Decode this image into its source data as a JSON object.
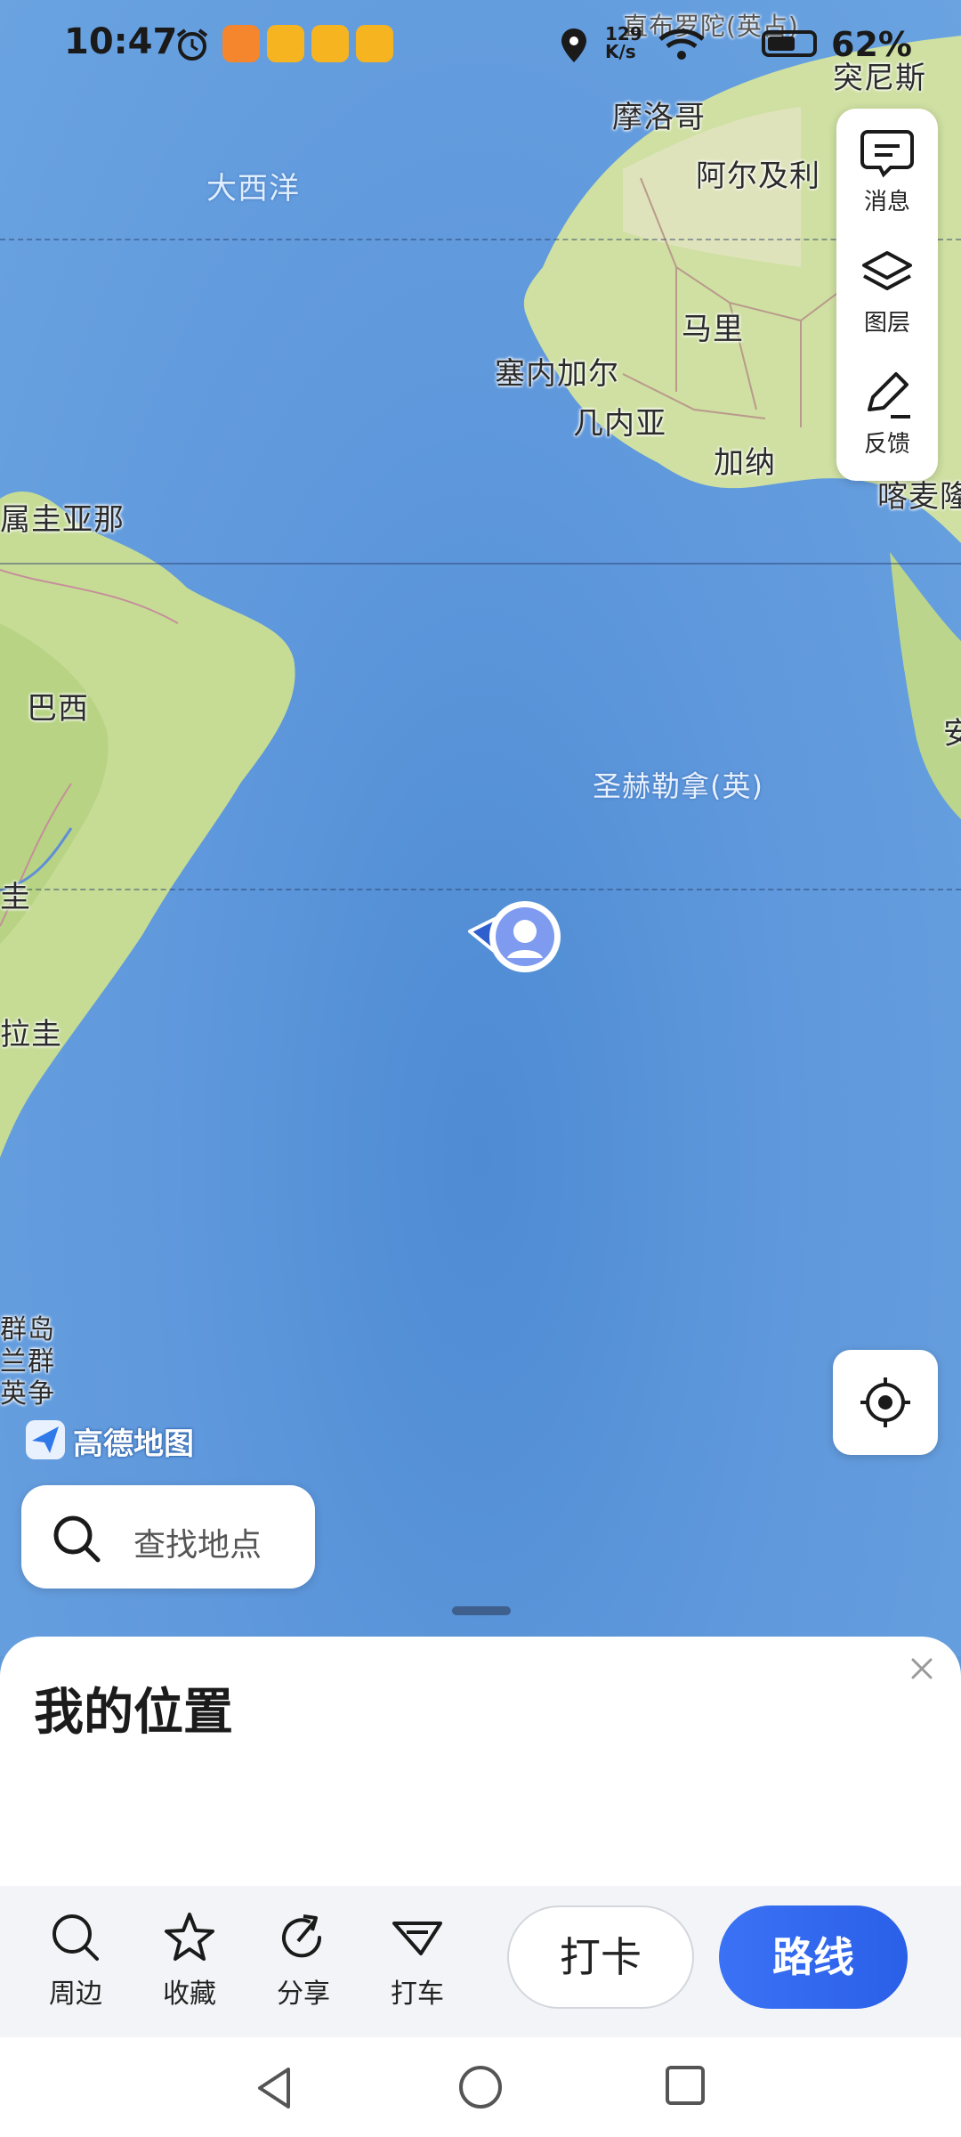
{
  "status_bar": {
    "time": "10:47",
    "net_speed_value": "129",
    "net_speed_unit": "K/s",
    "battery": "62%",
    "battery_level": 0.62
  },
  "map": {
    "ocean_labels": [
      "大西洋",
      "圣赫勒拿(英)"
    ],
    "labels": [
      "摩洛哥",
      "阿尔及利",
      "马里",
      "塞内加尔",
      "几内亚",
      "加纳",
      "突尼斯",
      "属圭亚那",
      "巴西",
      "圭",
      "拉圭",
      "群岛",
      "兰群",
      "英争",
      "喀麦隆",
      "安"
    ],
    "top_partial_label": "直布罗陀(英占)",
    "logo_text": "高德地图"
  },
  "tools": {
    "messages": "消息",
    "layers": "图层",
    "feedback": "反馈"
  },
  "search": {
    "placeholder": "查找地点"
  },
  "sheet": {
    "title": "我的位置",
    "actions": [
      "周边",
      "收藏",
      "分享",
      "打车"
    ],
    "checkin": "打卡",
    "route": "路线"
  },
  "colors": {
    "ocean": "#5f98d9",
    "land": "#c9dd9a",
    "route_button": "#3b72f5"
  }
}
